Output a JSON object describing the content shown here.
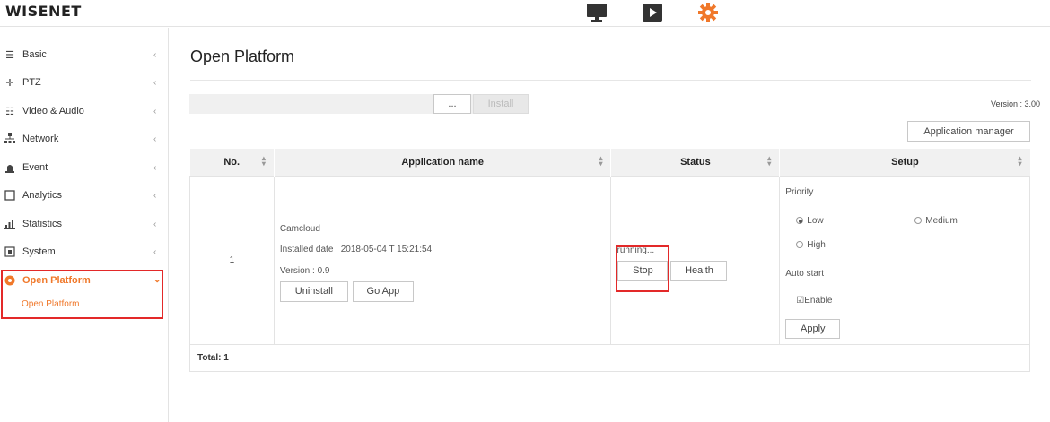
{
  "app": {
    "logo": "WISENET",
    "top_icons": [
      "monitor-icon",
      "play-icon",
      "gear-icon"
    ],
    "accent_color": "#f0782a",
    "highlight_color": "#e32929"
  },
  "sidebar": {
    "items": [
      {
        "label": "Basic",
        "icon": "list-icon",
        "chevron": "‹"
      },
      {
        "label": "PTZ",
        "icon": "move-icon",
        "chevron": "‹"
      },
      {
        "label": "Video & Audio",
        "icon": "video-icon",
        "chevron": "‹"
      },
      {
        "label": "Network",
        "icon": "network-icon",
        "chevron": "‹"
      },
      {
        "label": "Event",
        "icon": "siren-icon",
        "chevron": "‹"
      },
      {
        "label": "Analytics",
        "icon": "analytics-icon",
        "chevron": "‹"
      },
      {
        "label": "Statistics",
        "icon": "bar-chart-icon",
        "chevron": "‹"
      },
      {
        "label": "System",
        "icon": "system-icon",
        "chevron": "‹"
      },
      {
        "label": "Open Platform",
        "icon": "open-platform-icon",
        "chevron": "⌄",
        "active": true
      }
    ],
    "subitem": "Open Platform"
  },
  "main": {
    "title": "Open Platform",
    "browse_button": "...",
    "install_button": "Install",
    "version_text": "Version : 3.00",
    "app_manager_button": "Application manager",
    "table": {
      "headers": [
        "No.",
        "Application name",
        "Status",
        "Setup"
      ],
      "row": {
        "no": "1",
        "app_name": "Camcloud",
        "installed_date": "Installed date : 2018-05-04 T 15:21:54",
        "version": "Version : 0.9",
        "uninstall_button": "Uninstall",
        "go_app_button": "Go App",
        "status_text": "running...",
        "stop_button": "Stop",
        "health_button": "Health",
        "priority_label": "Priority",
        "priority_options": [
          "Low",
          "Medium",
          "High"
        ],
        "priority_selected": "Low",
        "auto_start_label": "Auto start",
        "enable_label": "Enable",
        "enable_checked": true,
        "apply_button": "Apply"
      },
      "total": "Total: 1"
    }
  }
}
